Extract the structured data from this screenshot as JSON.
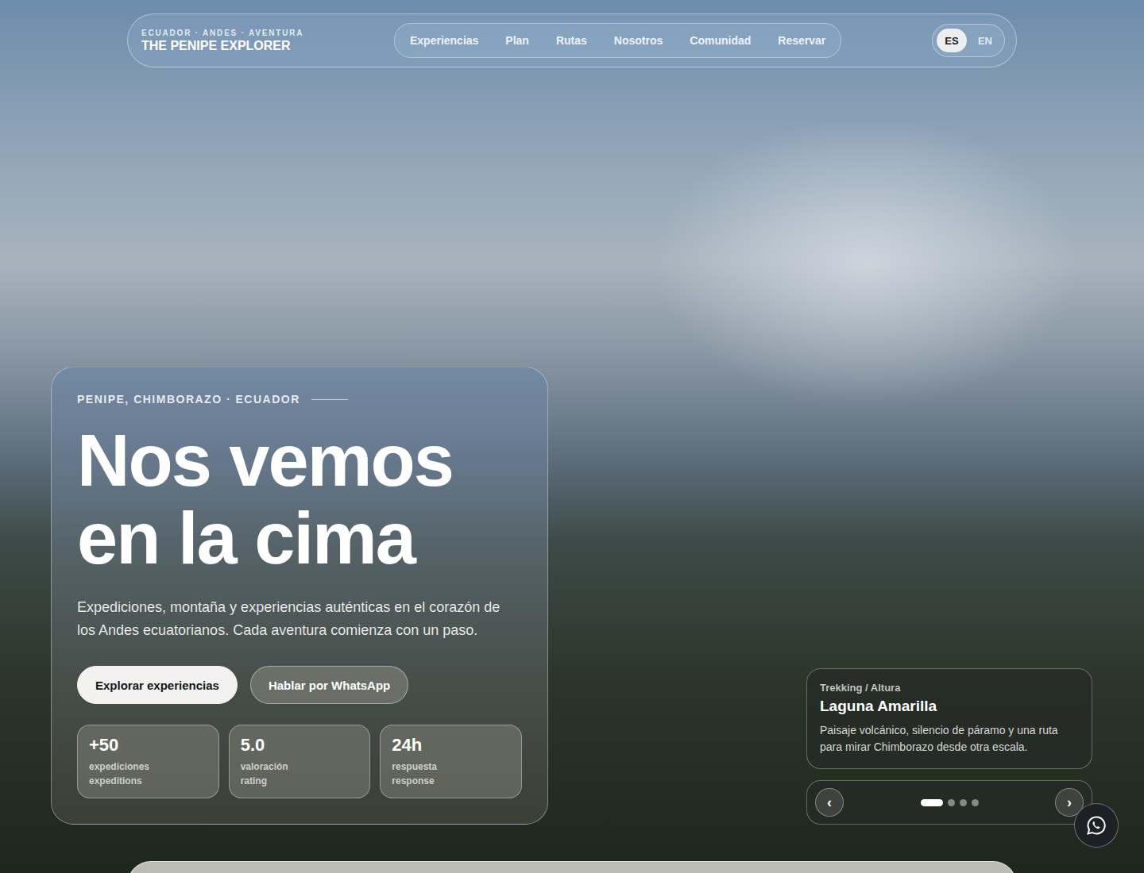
{
  "brand": {
    "tagline": "ECUADOR · ANDES · AVENTURA",
    "name": "THE PENIPE EXPLORER"
  },
  "nav": [
    {
      "label": "Experiencias"
    },
    {
      "label": "Plan"
    },
    {
      "label": "Rutas"
    },
    {
      "label": "Nosotros"
    },
    {
      "label": "Comunidad"
    },
    {
      "label": "Reservar"
    }
  ],
  "languages": [
    {
      "label": "ES",
      "selected": true
    },
    {
      "label": "EN",
      "selected": false
    }
  ],
  "hero": {
    "eyebrow": "PENIPE, CHIMBORAZO · ECUADOR",
    "headline_lines": [
      "Nos vemos",
      "en la cima"
    ],
    "description": "Expediciones, montaña y experiencias auténticas en el corazón de los Andes ecuatorianos. Cada aventura comienza con un paso.",
    "buttons": [
      {
        "label": "Explorar experiencias",
        "kind": "primary"
      },
      {
        "label": "Hablar por WhatsApp",
        "kind": "secondary"
      }
    ],
    "stats": [
      {
        "value": "+50",
        "label": "expediciones",
        "label_en": "expeditions"
      },
      {
        "value": "5.0",
        "label": "valoración",
        "label_en": "rating"
      },
      {
        "value": "24h",
        "label": "respuesta",
        "label_en": "response"
      }
    ]
  },
  "carousel": {
    "slide": {
      "tag": "Trekking / Altura",
      "title": "Laguna Amarilla",
      "description": "Paisaje volcánico, silencio de páramo y una ruta para mirar Chimborazo desde otra escala."
    },
    "prev": "‹",
    "next": "›",
    "dots": [
      {
        "selected": true
      },
      {
        "selected": false
      },
      {
        "selected": false
      },
      {
        "selected": false
      }
    ]
  }
}
